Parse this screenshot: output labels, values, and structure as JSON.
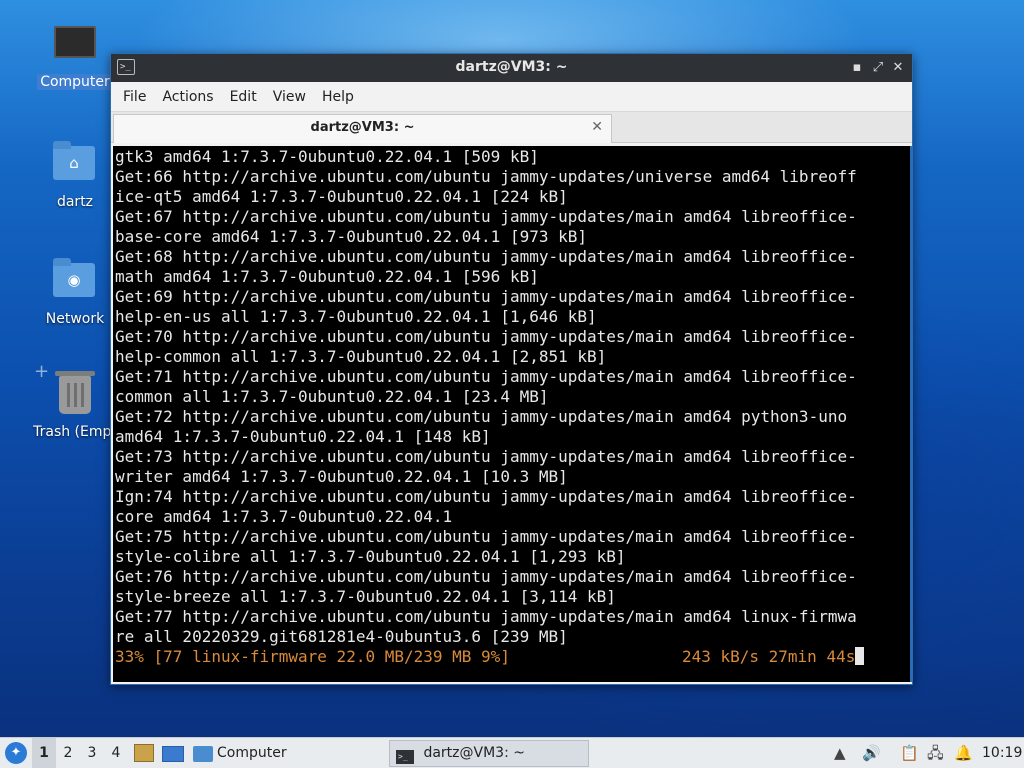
{
  "desktop": {
    "icons": [
      {
        "label": "Computer"
      },
      {
        "label": "dartz"
      },
      {
        "label": "Network"
      },
      {
        "label": "Trash (Empt"
      }
    ]
  },
  "window": {
    "title": "dartz@VM3: ~",
    "controls": {
      "minimize": "▪",
      "maximize": "⤢",
      "close": "✕"
    },
    "menu": [
      "File",
      "Actions",
      "Edit",
      "View",
      "Help"
    ],
    "tab": {
      "title": "dartz@VM3: ~",
      "close": "✕"
    }
  },
  "terminal": {
    "lines": [
      "gtk3 amd64 1:7.3.7-0ubuntu0.22.04.1 [509 kB]",
      "Get:66 http://archive.ubuntu.com/ubuntu jammy-updates/universe amd64 libreoff",
      "ice-qt5 amd64 1:7.3.7-0ubuntu0.22.04.1 [224 kB]",
      "Get:67 http://archive.ubuntu.com/ubuntu jammy-updates/main amd64 libreoffice-",
      "base-core amd64 1:7.3.7-0ubuntu0.22.04.1 [973 kB]",
      "Get:68 http://archive.ubuntu.com/ubuntu jammy-updates/main amd64 libreoffice-",
      "math amd64 1:7.3.7-0ubuntu0.22.04.1 [596 kB]",
      "Get:69 http://archive.ubuntu.com/ubuntu jammy-updates/main amd64 libreoffice-",
      "help-en-us all 1:7.3.7-0ubuntu0.22.04.1 [1,646 kB]",
      "Get:70 http://archive.ubuntu.com/ubuntu jammy-updates/main amd64 libreoffice-",
      "help-common all 1:7.3.7-0ubuntu0.22.04.1 [2,851 kB]",
      "Get:71 http://archive.ubuntu.com/ubuntu jammy-updates/main amd64 libreoffice-",
      "common all 1:7.3.7-0ubuntu0.22.04.1 [23.4 MB]",
      "Get:72 http://archive.ubuntu.com/ubuntu jammy-updates/main amd64 python3-uno",
      "amd64 1:7.3.7-0ubuntu0.22.04.1 [148 kB]",
      "Get:73 http://archive.ubuntu.com/ubuntu jammy-updates/main amd64 libreoffice-",
      "writer amd64 1:7.3.7-0ubuntu0.22.04.1 [10.3 MB]",
      "Ign:74 http://archive.ubuntu.com/ubuntu jammy-updates/main amd64 libreoffice-",
      "core amd64 1:7.3.7-0ubuntu0.22.04.1",
      "Get:75 http://archive.ubuntu.com/ubuntu jammy-updates/main amd64 libreoffice-",
      "style-colibre all 1:7.3.7-0ubuntu0.22.04.1 [1,293 kB]",
      "Get:76 http://archive.ubuntu.com/ubuntu jammy-updates/main amd64 libreoffice-",
      "style-breeze all 1:7.3.7-0ubuntu0.22.04.1 [3,114 kB]",
      "Get:77 http://archive.ubuntu.com/ubuntu jammy-updates/main amd64 linux-firmwa",
      "re all 20220329.git681281e4-0ubuntu3.6 [239 MB]"
    ],
    "status_left": "33% [77 linux-firmware 22.0 MB/239 MB 9%]",
    "status_right": "243 kB/s 27min 44s",
    "status_color": "#d98a3a"
  },
  "taskbar": {
    "workspaces": [
      "1",
      "2",
      "3",
      "4"
    ],
    "active_workspace": "1",
    "launchers": [
      {
        "label": "Computer"
      }
    ],
    "tasks": [
      {
        "label": "dartz@VM3: ~"
      }
    ],
    "clock": "10:19"
  }
}
